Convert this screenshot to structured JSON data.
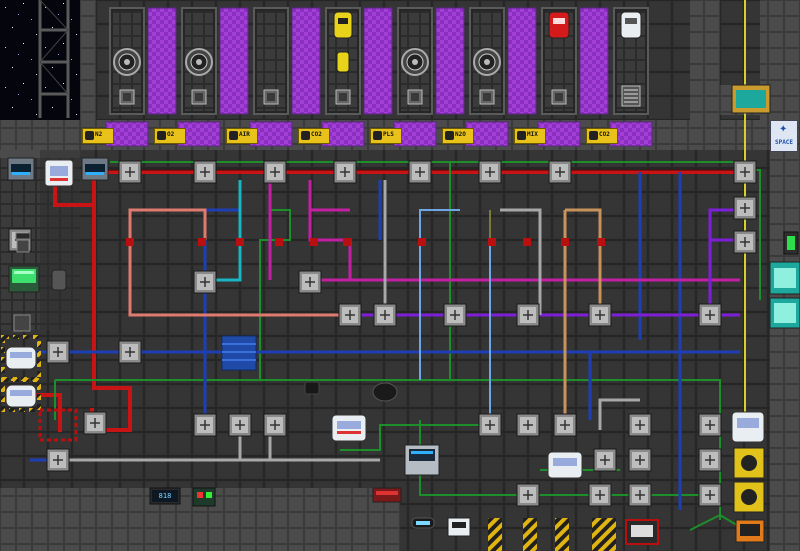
{
  "scene": {
    "palette": {
      "floor": "#2f2f2f",
      "floor_line": "#232323",
      "wall": "#4a4a4a",
      "space": "#05060d",
      "pipe_red": "#c81414",
      "pipe_blue": "#1d3fb3",
      "pipe_green": "#1c8f2a",
      "pipe_cyan": "#19b5c4",
      "pipe_magenta": "#c21fa3",
      "pipe_purple": "#7d1fd6",
      "pipe_salmon": "#e07a6e",
      "pipe_tan": "#c8935a",
      "pipe_grey": "#a8a8a8",
      "pipe_yellow": "#d9cf2a",
      "pipe_lightblue": "#6fa6e6",
      "pipe_olive": "#7a7a3a",
      "plasma_glass": "#9a36c8",
      "hazard": "#e0b411"
    },
    "gas_chambers": {
      "count": 8,
      "chambers": [
        {
          "contents": "turbine-vent",
          "tank": ""
        },
        {
          "contents": "turbine-vent",
          "tank": ""
        },
        {
          "contents": "vent",
          "tank": ""
        },
        {
          "contents": "vent",
          "tank": "yellow-canister"
        },
        {
          "contents": "turbine-vent",
          "tank": ""
        },
        {
          "contents": "turbine-vent",
          "tank": ""
        },
        {
          "contents": "vent",
          "tank": "red-canister"
        },
        {
          "contents": "grille-vent",
          "tank": "white-canister"
        }
      ]
    },
    "chamber_signs": [
      {
        "label": "N2"
      },
      {
        "label": "O2"
      },
      {
        "label": "AIR"
      },
      {
        "label": "CO2"
      },
      {
        "label": "PLS"
      },
      {
        "label": "N2O"
      },
      {
        "label": "MIX"
      },
      {
        "label": "CO2"
      }
    ],
    "space_sign": {
      "label": "SPACE",
      "glyph": "✦",
      "icon": "space-warning-icon"
    },
    "console_readout": {
      "value": "818"
    }
  }
}
